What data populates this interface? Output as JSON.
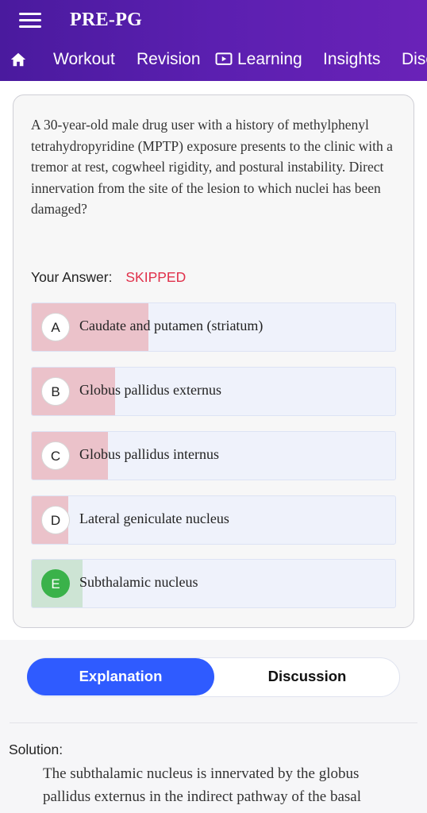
{
  "app": {
    "title": "PRE-PG"
  },
  "nav": {
    "home_icon": "home-icon",
    "items": [
      {
        "label": "Workout"
      },
      {
        "label": "Revision"
      },
      {
        "label": "Learning",
        "icon": "play-screen-icon"
      },
      {
        "label": "Insights"
      },
      {
        "label": "Disc"
      }
    ]
  },
  "question": {
    "text": "A 30-year-old male drug user with a history of methylphenyl tetrahydropyridine (MPTP) exposure presents to the clinic with a tremor at rest, cogwheel rigidity, and postural instability. Direct innervation from the site of the lesion to which nuclei has been damaged?",
    "your_answer_label": "Your Answer:",
    "your_answer_value": "SKIPPED",
    "options": [
      {
        "letter": "A",
        "text": "Caudate and putamen (striatum)",
        "response_fraction": 0.32,
        "correct": false
      },
      {
        "letter": "B",
        "text": "Globus pallidus externus",
        "response_fraction": 0.23,
        "correct": false
      },
      {
        "letter": "C",
        "text": "Globus pallidus internus",
        "response_fraction": 0.21,
        "correct": false
      },
      {
        "letter": "D",
        "text": "Lateral geniculate nucleus",
        "response_fraction": 0.1,
        "correct": false
      },
      {
        "letter": "E",
        "text": "Subthalamic nucleus",
        "response_fraction": 0.14,
        "correct": true
      }
    ]
  },
  "tabs": {
    "explanation": "Explanation",
    "discussion": "Discussion"
  },
  "solution": {
    "label": "Solution:",
    "text": "The subthalamic nucleus is innervated by the globus pallidus externus in the indirect pathway of the basal"
  },
  "colors": {
    "header": "#5b1fb0",
    "skipped": "#e0314b",
    "wrong_fill": "#ebc2ca",
    "correct_fill": "#cde4d4",
    "correct_badge": "#3ab24a",
    "active_tab": "#2f5bff"
  }
}
